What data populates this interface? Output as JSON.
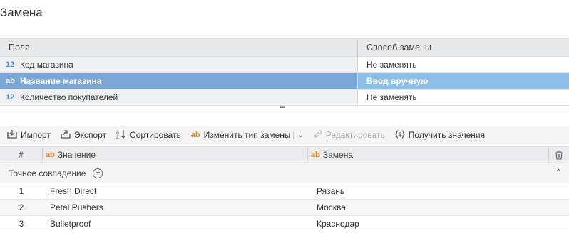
{
  "title": "Замена",
  "fields_table": {
    "col_fields": "Поля",
    "col_method": "Способ замены",
    "rows": [
      {
        "type": "12",
        "name": "Код магазина",
        "method": "Не заменять"
      },
      {
        "type": "ab",
        "name": "Название магазина",
        "method": "Ввод вручную"
      },
      {
        "type": "12",
        "name": "Количество покупателей",
        "method": "Не заменять"
      }
    ]
  },
  "splitter_dots": "•••",
  "toolbar": {
    "import": "Импорт",
    "export": "Экспорт",
    "sort": "Сортировать",
    "change_type": "Изменить тип замены",
    "edit": "Редактировать",
    "get_values": "Получить значения"
  },
  "values_table": {
    "col_num": "#",
    "col_value": "Значение",
    "col_replace": "Замена",
    "group_label": "Точное совпадение",
    "rows": [
      {
        "num": "1",
        "value": "Fresh Direct",
        "replace": "Рязань"
      },
      {
        "num": "2",
        "value": "Petal Pushers",
        "replace": "Москва"
      },
      {
        "num": "3",
        "value": "Bulletproof",
        "replace": "Краснодар"
      }
    ]
  },
  "colors": {
    "selected_row": "#7ba7d8",
    "selected_cell": "#8dc0e8",
    "type_num": "#4a90d9",
    "type_text": "#e08a1e"
  }
}
